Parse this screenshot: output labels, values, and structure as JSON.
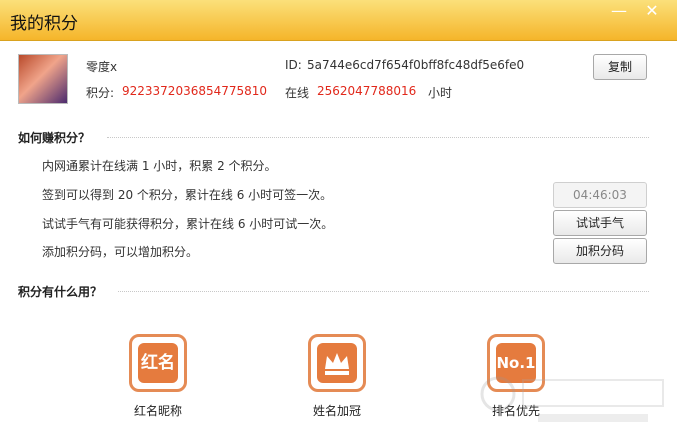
{
  "window": {
    "title": "我的积分"
  },
  "profile": {
    "username": "零度x",
    "id_label": "ID:",
    "id_value": "5a744e6cd7f654f0bff8fc48df5e6fe0",
    "points_label": "积分:",
    "points_value": "9223372036854775810",
    "online_label": "在线",
    "online_value": "2562047788016",
    "online_unit": "小时",
    "copy_button": "复制"
  },
  "earn": {
    "heading": "如何赚积分？",
    "items": [
      {
        "text": "内网通累计在线满 1 小时，积累 2 个积分。"
      },
      {
        "text": "签到可以得到 20 个积分，累计在线 6 小时可签一次。",
        "button": "04:46:03"
      },
      {
        "text": "试试手气有可能获得积分，累计在线 6 小时可试一次。",
        "button": "试试手气"
      },
      {
        "text": "添加积分码，可以增加积分。",
        "button": "加积分码"
      }
    ]
  },
  "use": {
    "heading": "积分有什么用？",
    "features": [
      {
        "icon_text": "红名",
        "label": "红名昵称"
      },
      {
        "icon_text": "",
        "label": "姓名加冠"
      },
      {
        "icon_text": "No.1",
        "label": "排名优先"
      }
    ]
  },
  "colors": {
    "accent": "#f5b52a",
    "red": "#e1281b",
    "icon_orange": "#e57b3e"
  }
}
